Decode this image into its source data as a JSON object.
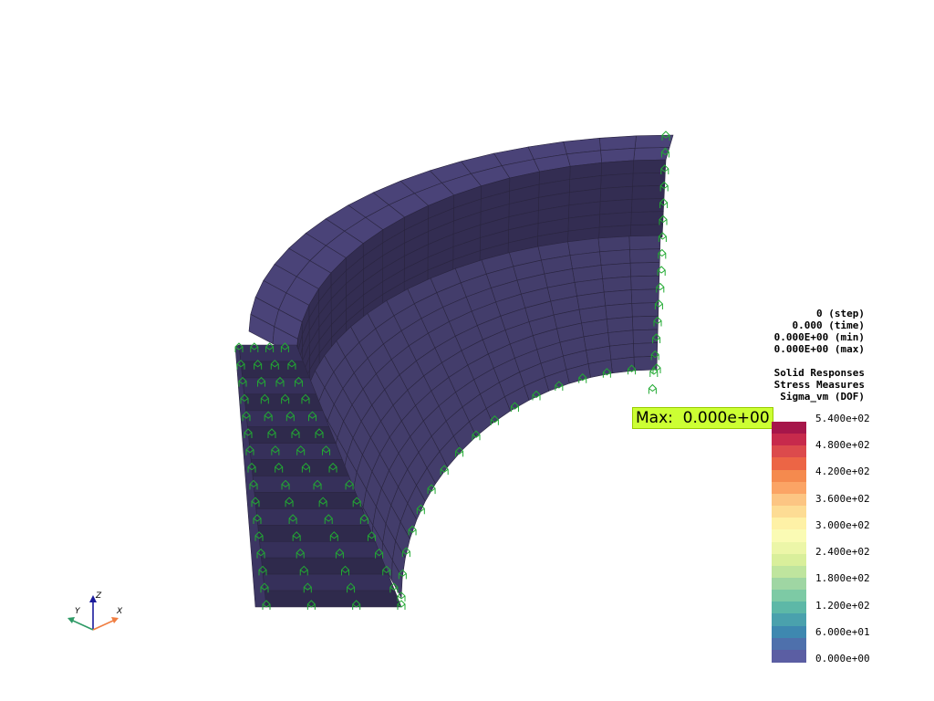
{
  "viewer": {
    "step": "0 (step)",
    "time": "0.000 (time)",
    "min": "0.000E+00 (min)",
    "max": "0.000E+00 (max)",
    "result_group": "Solid Responses",
    "result_category": "Stress Measures",
    "result_component": "Sigma_vm (DOF)",
    "max_label": "Max:  0.000e+00",
    "mesh_color": "#433d6b",
    "constraint_color": "#22aa33"
  },
  "colorbar": {
    "ticks": [
      "5.400e+02",
      "4.800e+02",
      "4.200e+02",
      "3.600e+02",
      "3.000e+02",
      "2.400e+02",
      "1.800e+02",
      "1.200e+02",
      "6.000e+01",
      "0.000e+00"
    ],
    "colors": [
      "#a6164a",
      "#c72a4c",
      "#dc4a4c",
      "#ec6545",
      "#f58a4e",
      "#fba465",
      "#fcc583",
      "#fddc94",
      "#fef1a6",
      "#fafbb4",
      "#ecf6a8",
      "#d9ef9b",
      "#bfe59e",
      "#9fd6a3",
      "#7dcaa5",
      "#5db8a7",
      "#4aa1ad",
      "#3e88b0",
      "#4e70ac",
      "#5b5ea3"
    ],
    "scale_min": 0,
    "scale_max": 540
  },
  "axes": {
    "x": "X",
    "y": "Y",
    "z": "Z"
  }
}
